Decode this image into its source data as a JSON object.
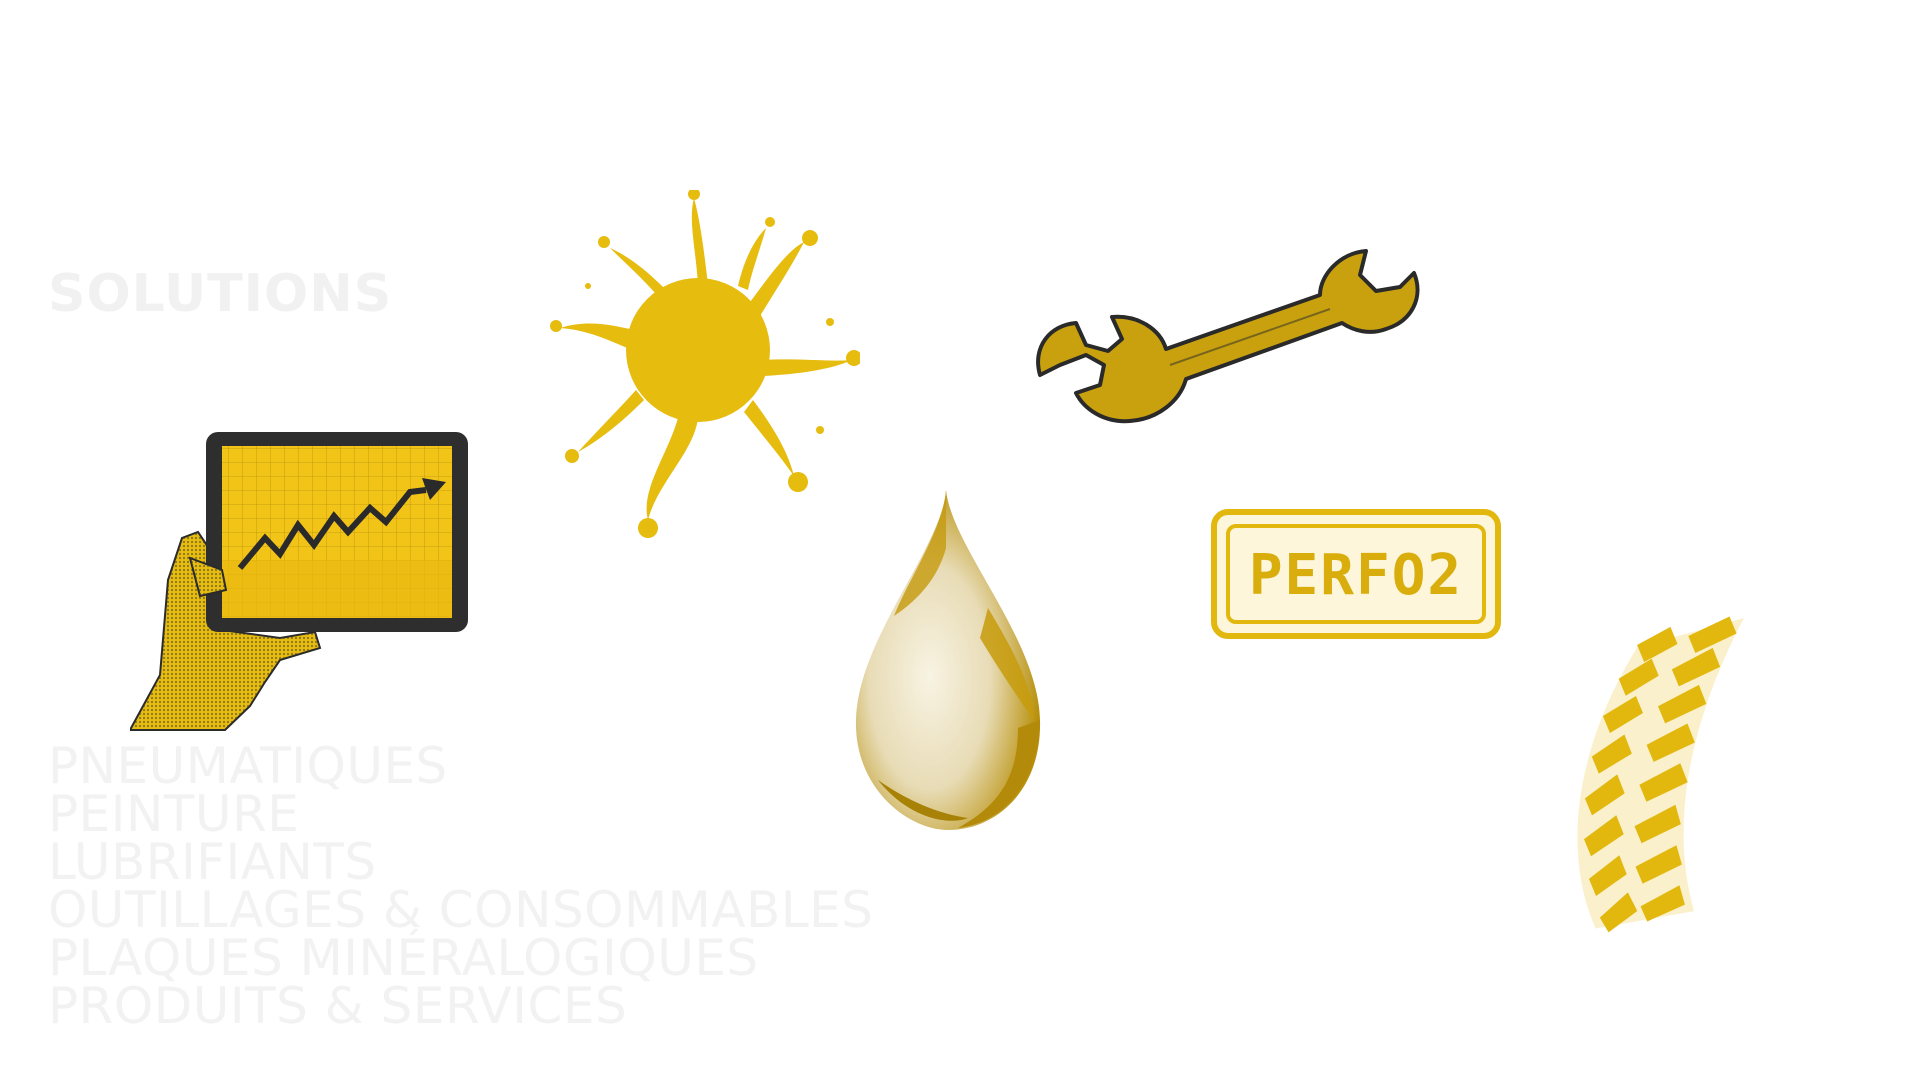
{
  "heading": "SOLUTIONS",
  "solutions": [
    "PNEUMATIQUES",
    "PEINTURE",
    "LUBRIFIANTS",
    "OUTILLAGES & CONSOMMABLES",
    "PLAQUES MINÉRALOGIQUES",
    "PRODUITS & SERVICES"
  ],
  "plate_text": "PERFO2",
  "colors": {
    "gold": "#e6bc0e",
    "gold_dark": "#b88f0a",
    "ink": "#2a2a2a",
    "faint_text": "#f1f1f1"
  },
  "icons": [
    "tablet-chart-icon",
    "paint-splash-icon",
    "oil-drop-icon",
    "wrench-icon",
    "license-plate-icon",
    "tire-track-icon"
  ]
}
